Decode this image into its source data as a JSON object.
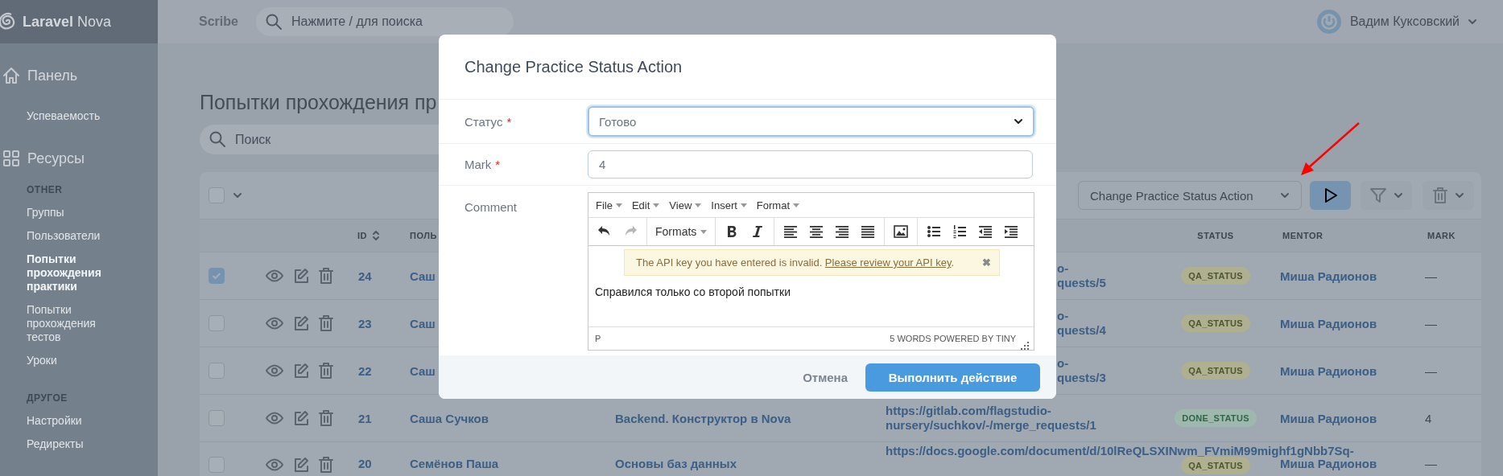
{
  "sidebar": {
    "brand": {
      "name": "Laravel",
      "suffix": "Nova"
    },
    "items": [
      {
        "kind": "section",
        "label": "Панель"
      },
      {
        "kind": "link",
        "label": "Успеваемость",
        "selected": false
      },
      {
        "kind": "section",
        "label": "Ресурсы"
      },
      {
        "kind": "heading",
        "label": "OTHER"
      },
      {
        "kind": "link",
        "label": "Группы",
        "selected": false
      },
      {
        "kind": "link",
        "label": "Пользователи",
        "selected": false
      },
      {
        "kind": "link",
        "label": "Попытки прохождения практики",
        "selected": true
      },
      {
        "kind": "link",
        "label": "Попытки прохождения тестов",
        "selected": false
      },
      {
        "kind": "link",
        "label": "Уроки",
        "selected": false
      },
      {
        "kind": "heading",
        "label": "ДРУГОЕ"
      },
      {
        "kind": "link",
        "label": "Настройки",
        "selected": false
      },
      {
        "kind": "link",
        "label": "Редиректы",
        "selected": false
      }
    ]
  },
  "topbar": {
    "app_name": "Scribe",
    "search": {
      "placeholder": "Нажмите / для поиска"
    },
    "user": "Вадим Куксовский"
  },
  "page_title": "Попытки прохождения пр",
  "search": {
    "placeholder": "Поиск"
  },
  "table": {
    "select_all": {
      "checked": false
    },
    "action": {
      "value": "Change Practice Status Action"
    },
    "columns": [
      {
        "label": "ID",
        "sortable": true
      },
      {
        "label": "ПОЛЬ",
        "sortable": false
      },
      {
        "label": "STATUS",
        "sortable": false
      },
      {
        "label": "MENTOR",
        "sortable": false
      },
      {
        "label": "MARK",
        "sortable": false
      }
    ],
    "rows": [
      {
        "kind": "covered",
        "selected": true,
        "id": "24",
        "user": "Саш",
        "url": [
          "o-",
          "quests/5"
        ],
        "status": {
          "label": "QA_STATUS",
          "kind": "qa"
        },
        "mentor": "Миша Радионов",
        "mark": "—"
      },
      {
        "kind": "covered",
        "selected": false,
        "id": "23",
        "user": "Саш",
        "url": [
          "o-",
          "quests/4"
        ],
        "status": {
          "label": "QA_STATUS",
          "kind": "qa"
        },
        "mentor": "Миша Радионов",
        "mark": "—"
      },
      {
        "kind": "covered",
        "selected": false,
        "id": "22",
        "user": "Саш",
        "url": [
          "o-",
          "quests/3"
        ],
        "status": {
          "label": "QA_STATUS",
          "kind": "qa"
        },
        "mentor": "Миша Радионов",
        "mark": "—"
      },
      {
        "kind": "full",
        "selected": false,
        "id": "21",
        "user": "Саша Сучков",
        "course": "Backend. Конструктор в Nova",
        "url": [
          "https://gitlab.com/flagstudio-",
          "nursery/suchkov/-/merge_requests/1"
        ],
        "status": {
          "label": "DONE_STATUS",
          "kind": "done"
        },
        "mentor": "Миша Радионов",
        "mark": "4"
      },
      {
        "kind": "full",
        "selected": false,
        "id": "20",
        "user": "Семёнов Паша",
        "course": "Основы баз данных",
        "url": [
          "https://docs.google.com/document/d/10lReQLSXINwm_FVmiM99mighf1gNbb7Sq-"
        ],
        "status": {
          "label": "QA_STATUS",
          "kind": "qa"
        },
        "mentor": "Миша Радионов",
        "mark": "—"
      }
    ]
  },
  "modal": {
    "title": "Change Practice Status Action",
    "required_mark": "*",
    "fields": [
      {
        "kind": "select",
        "label": "Статус",
        "required": true,
        "value": "Готово"
      },
      {
        "kind": "text",
        "label": "Mark",
        "required": true,
        "value": "4"
      },
      {
        "kind": "editor",
        "label": "Comment",
        "required": false
      }
    ],
    "editor": {
      "menus": [
        "File",
        "Edit",
        "View",
        "Insert",
        "Format"
      ],
      "toolbar": [
        [
          {
            "kind": "undo",
            "disabled": false
          },
          {
            "kind": "redo",
            "disabled": true
          }
        ],
        [
          {
            "kind": "formats",
            "label": "Formats"
          }
        ],
        [
          {
            "kind": "bold"
          },
          {
            "kind": "italic"
          }
        ],
        [
          {
            "kind": "align-left"
          },
          {
            "kind": "align-center"
          },
          {
            "kind": "align-right"
          },
          {
            "kind": "justify"
          }
        ],
        [
          {
            "kind": "image"
          }
        ],
        [
          {
            "kind": "bullets"
          },
          {
            "kind": "numbers"
          },
          {
            "kind": "outdent"
          },
          {
            "kind": "indent"
          }
        ]
      ],
      "notice": {
        "text": "The API key you have entered is invalid. ",
        "link": "Please review your API key",
        "after": ".",
        "close": "✖"
      },
      "content": "Справился только со второй попытки",
      "path": "P",
      "status": "5 WORDS POWERED BY TINY"
    },
    "cancel": "Отмена",
    "submit": "Выполнить действие"
  }
}
